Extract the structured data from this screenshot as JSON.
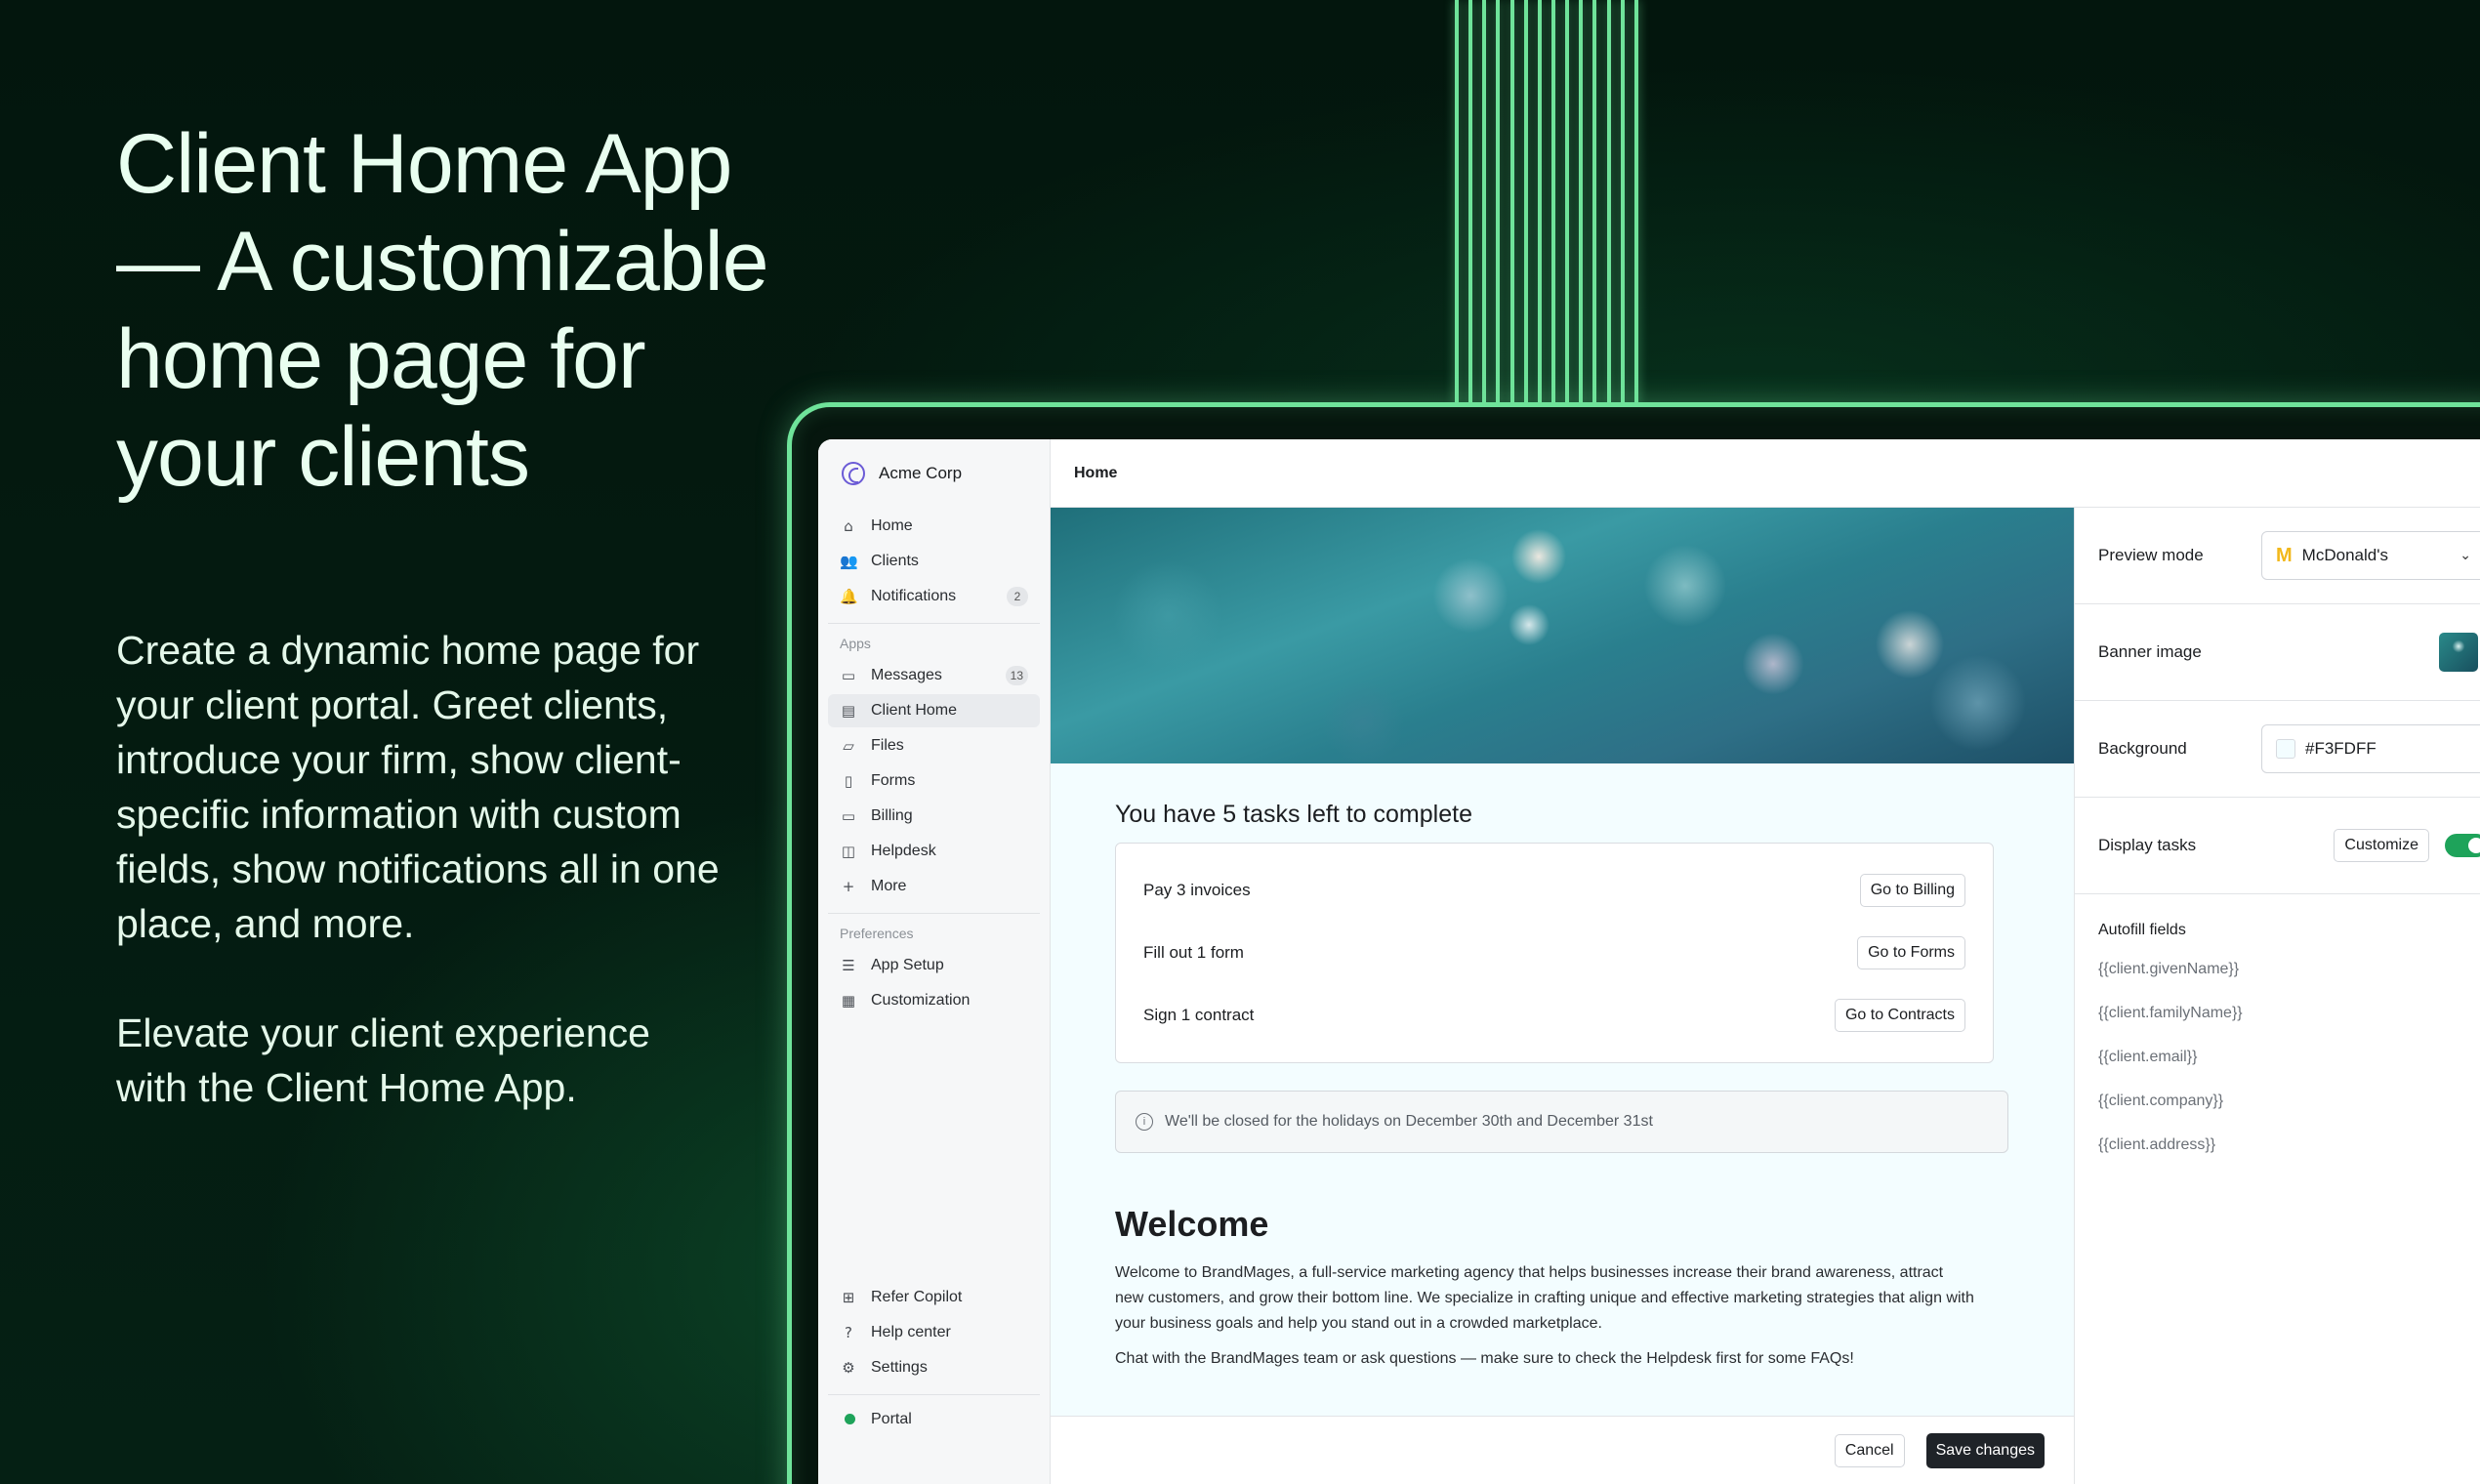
{
  "hero": {
    "headline": "Client Home App — A customizable home page for your clients",
    "paragraph1": "Create a dynamic home page for your client portal. Greet clients, introduce your firm, show client-specific information with custom fields, show notifications all in one place, and more.",
    "paragraph2": "Elevate your client experience with the Client Home App."
  },
  "colors": {
    "accent": "#6fe39a",
    "background": "#041a10",
    "toggle_on": "#1ea35a",
    "preview_bg": "#F3FDFF"
  },
  "sidebar": {
    "org_name": "Acme Corp",
    "main_items": [
      {
        "label": "Home",
        "icon": "home-icon"
      },
      {
        "label": "Clients",
        "icon": "users-icon"
      },
      {
        "label": "Notifications",
        "icon": "bell-icon",
        "badge": "2"
      }
    ],
    "apps_label": "Apps",
    "app_items": [
      {
        "label": "Messages",
        "icon": "message-icon",
        "badge": "13"
      },
      {
        "label": "Client Home",
        "icon": "client-home-icon",
        "active": true
      },
      {
        "label": "Files",
        "icon": "folder-icon"
      },
      {
        "label": "Forms",
        "icon": "form-icon"
      },
      {
        "label": "Billing",
        "icon": "card-icon"
      },
      {
        "label": "Helpdesk",
        "icon": "book-icon"
      },
      {
        "label": "More",
        "icon": "plus-icon"
      }
    ],
    "preferences_label": "Preferences",
    "pref_items": [
      {
        "label": "App Setup",
        "icon": "sliders-icon"
      },
      {
        "label": "Customization",
        "icon": "grid-icon"
      }
    ],
    "bottom_items": [
      {
        "label": "Refer Copilot",
        "icon": "gift-icon"
      },
      {
        "label": "Help center",
        "icon": "help-icon"
      },
      {
        "label": "Settings",
        "icon": "gear-icon"
      }
    ],
    "portal_label": "Portal"
  },
  "topbar": {
    "title": "Home"
  },
  "preview": {
    "tasks_title": "You have 5 tasks left to complete",
    "tasks": [
      {
        "label": "Pay 3 invoices",
        "button": "Go to Billing"
      },
      {
        "label": "Fill out 1 form",
        "button": "Go to Forms"
      },
      {
        "label": "Sign 1 contract",
        "button": "Go to Contracts"
      }
    ],
    "notice": "We'll be closed for the holidays on December 30th and December 31st",
    "welcome_title": "Welcome",
    "welcome_p1": "Welcome to BrandMages, a full-service marketing agency that helps businesses increase their brand awareness, attract new customers, and grow their bottom line. We specialize in crafting unique and effective marketing strategies that align with your business goals and help you stand out in a crowded marketplace.",
    "welcome_p2": "Chat with the BrandMages team or ask questions — make sure to check the Helpdesk first for some FAQs!"
  },
  "footer": {
    "cancel": "Cancel",
    "save": "Save changes"
  },
  "panel": {
    "preview_mode_label": "Preview mode",
    "preview_mode_value": "McDonald's",
    "banner_label": "Banner image",
    "background_label": "Background",
    "background_value": "#F3FDFF",
    "display_tasks_label": "Display tasks",
    "customize_label": "Customize",
    "display_tasks_on": true,
    "autofill_title": "Autofill fields",
    "autofill_fields": [
      "{{client.givenName}}",
      "{{client.familyName}}",
      "{{client.email}}",
      "{{client.company}}",
      "{{client.address}}"
    ]
  }
}
